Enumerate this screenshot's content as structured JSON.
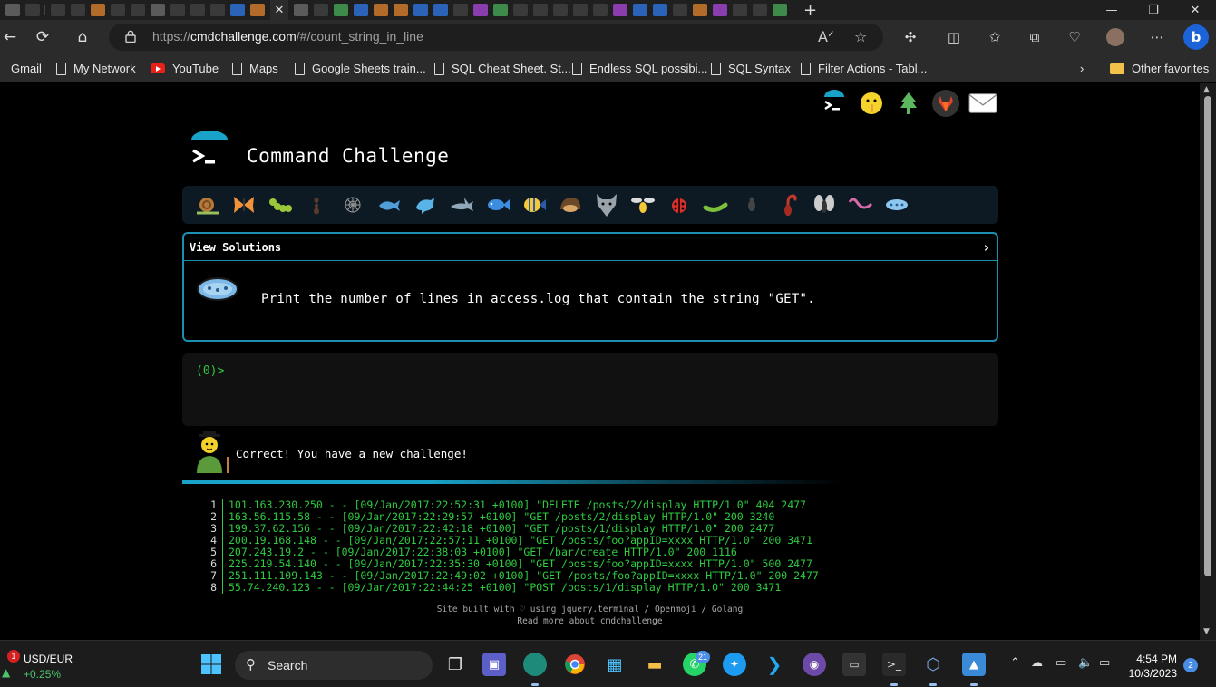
{
  "browser": {
    "url_prefix": "https://",
    "url_host": "cmdchallenge.com",
    "url_path": "/#/count_string_in_line",
    "active_tab_close": "✕",
    "bookmarks": [
      {
        "label": "Gmail",
        "icon": "gmail-icon"
      },
      {
        "label": "My Network",
        "icon": "document-icon"
      },
      {
        "label": "YouTube",
        "icon": "youtube-icon"
      },
      {
        "label": "Maps",
        "icon": "document-icon"
      },
      {
        "label": "Google Sheets train...",
        "icon": "document-icon"
      },
      {
        "label": "SQL Cheat Sheet. St...",
        "icon": "document-icon"
      },
      {
        "label": "Endless SQL possibi...",
        "icon": "document-icon"
      },
      {
        "label": "SQL Syntax",
        "icon": "document-icon"
      },
      {
        "label": "Filter Actions - Tabl...",
        "icon": "document-icon"
      }
    ],
    "other_favorites": "Other favorites"
  },
  "page": {
    "title": "Command Challenge",
    "view_solutions": "View Solutions",
    "chevron": "›",
    "challenge_text": "Print the number of lines in access.log that contain the string \"GET\".",
    "prompt": "(0)>",
    "result_message": "Correct! You have a new challenge!",
    "progress": 0.3,
    "log_lines": [
      {
        "n": "1",
        "text": "101.163.230.250 - - [09/Jan/2017:22:52:31 +0100] \"DELETE /posts/2/display HTTP/1.0\" 404 2477"
      },
      {
        "n": "2",
        "text": "163.56.115.58 - - [09/Jan/2017:22:29:57 +0100] \"GET /posts/2/display HTTP/1.0\" 200 3240"
      },
      {
        "n": "3",
        "text": "199.37.62.156 - - [09/Jan/2017:22:42:18 +0100] \"GET /posts/1/display HTTP/1.0\" 200 2477"
      },
      {
        "n": "4",
        "text": "200.19.168.148 - - [09/Jan/2017:22:57:11 +0100] \"GET /posts/foo?appID=xxxx HTTP/1.0\" 200 3471"
      },
      {
        "n": "5",
        "text": "207.243.19.2 - - [09/Jan/2017:22:38:03 +0100] \"GET /bar/create HTTP/1.0\" 200 1116"
      },
      {
        "n": "6",
        "text": "225.219.54.140 - - [09/Jan/2017:22:35:30 +0100] \"GET /posts/foo?appID=xxxx HTTP/1.0\" 500 2477"
      },
      {
        "n": "7",
        "text": "251.111.109.143 - - [09/Jan/2017:22:49:02 +0100] \"GET /posts/foo?appID=xxxx HTTP/1.0\" 200 2477"
      },
      {
        "n": "8",
        "text": "55.74.240.123 - - [09/Jan/2017:22:44:25 +0100] \"POST /posts/1/display HTTP/1.0\" 200 3471"
      }
    ],
    "footer_line1": "Site built with ♡ using jquery.terminal / Openmoji / Golang",
    "footer_line2": "Read more about cmdchallenge",
    "animals": [
      "snail-icon",
      "butterfly-icon",
      "caterpillar-icon",
      "ant-icon",
      "spider-web-icon",
      "whale-icon",
      "dolphin-icon",
      "shark-icon",
      "fish-icon",
      "tropical-fish-icon",
      "hedgehog-icon",
      "wolf-icon",
      "bee-icon",
      "ladybug-icon",
      "worm-icon",
      "beetle-icon",
      "scorpion-icon",
      "fly-icon",
      "snake-icon",
      "microbe-icon"
    ]
  },
  "taskbar": {
    "ticker_badge": "1",
    "ticker_pair": "USD/EUR",
    "ticker_change": "+0.25%",
    "search_label": "Search",
    "whatsapp_badge": "21",
    "time": "4:54 PM",
    "date": "10/3/2023",
    "notifications": "2"
  },
  "colors": {
    "accent_blue": "#1d8fb3",
    "terminal_green": "#2ecc40"
  }
}
